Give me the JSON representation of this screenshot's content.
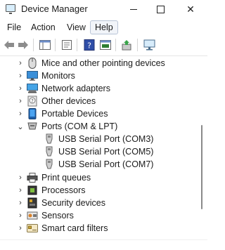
{
  "window": {
    "title": "Device Manager"
  },
  "menu": {
    "file": "File",
    "action": "Action",
    "view": "View",
    "help": "Help"
  },
  "tree": {
    "items": [
      {
        "label": "Mice and other pointing devices",
        "expanded": false,
        "icon": "mouse-icon"
      },
      {
        "label": "Monitors",
        "expanded": false,
        "icon": "monitor-icon"
      },
      {
        "label": "Network adapters",
        "expanded": false,
        "icon": "network-adapter-icon"
      },
      {
        "label": "Other devices",
        "expanded": false,
        "icon": "unknown-device-icon"
      },
      {
        "label": "Portable Devices",
        "expanded": false,
        "icon": "portable-device-icon"
      },
      {
        "label": "Ports (COM & LPT)",
        "expanded": true,
        "icon": "port-icon",
        "children": [
          {
            "label": "USB Serial Port (COM3)",
            "icon": "serial-port-icon"
          },
          {
            "label": "USB Serial Port (COM5)",
            "icon": "serial-port-icon"
          },
          {
            "label": "USB Serial Port (COM7)",
            "icon": "serial-port-icon"
          }
        ]
      },
      {
        "label": "Print queues",
        "expanded": false,
        "icon": "printer-icon"
      },
      {
        "label": "Processors",
        "expanded": false,
        "icon": "processor-icon"
      },
      {
        "label": "Security devices",
        "expanded": false,
        "icon": "security-device-icon"
      },
      {
        "label": "Sensors",
        "expanded": false,
        "icon": "sensor-icon"
      },
      {
        "label": "Smart card filters",
        "expanded": false,
        "icon": "smart-card-icon"
      }
    ]
  }
}
